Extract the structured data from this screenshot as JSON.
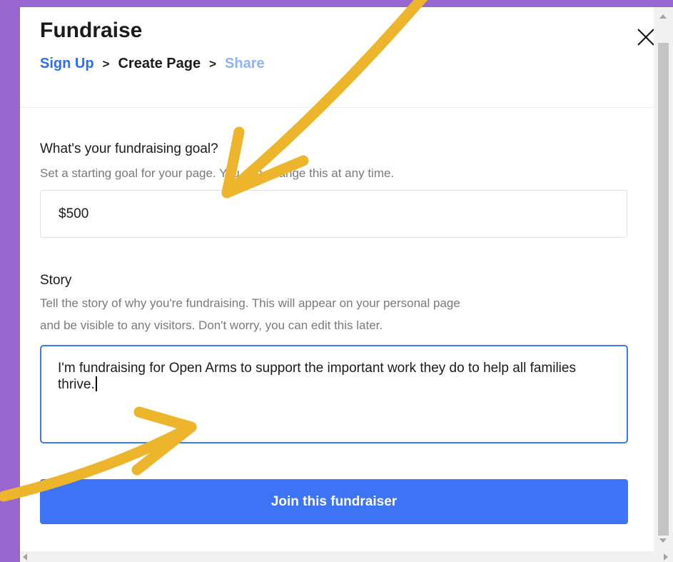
{
  "modal": {
    "title": "Fundraise",
    "close_icon": "close-icon"
  },
  "breadcrumb": {
    "items": [
      "Sign Up",
      "Create Page",
      "Share"
    ],
    "separator": ">"
  },
  "goal": {
    "label": "What's your fundraising goal?",
    "hint": "Set a starting goal for your page. You can change this at any time.",
    "value": "$500"
  },
  "story": {
    "label": "Story",
    "hint_line1": "Tell the story of why you're fundraising. This will appear on your personal page",
    "hint_line2": "and be visible to any visitors. Don't worry, you can edit this later.",
    "value": "I'm fundraising for Open Arms to support the important work they do to help all families thrive."
  },
  "actions": {
    "join_label": "Join this fundraiser"
  },
  "colors": {
    "background": "#9766cf",
    "accent": "#3d74f5",
    "link": "#2d6ff2",
    "annotation_arrow": "#edb52b"
  }
}
